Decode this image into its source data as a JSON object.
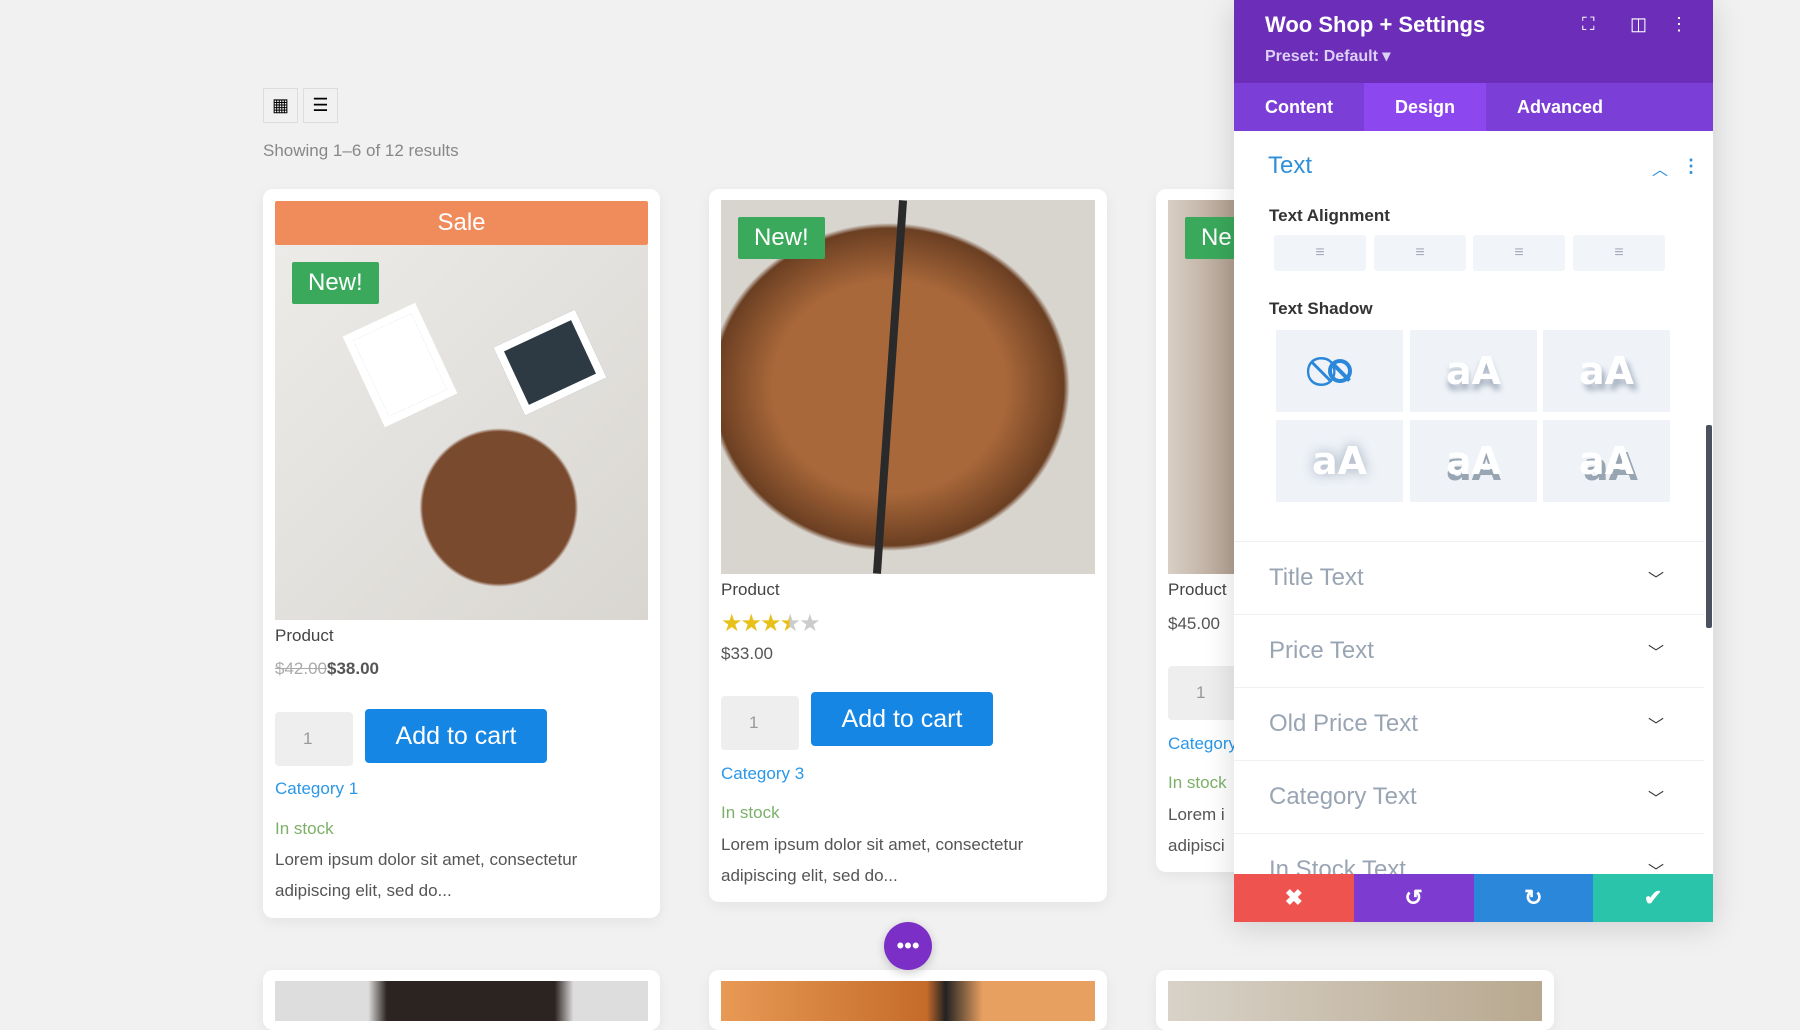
{
  "toolbar": {
    "grid_icon": "grid-view-icon",
    "list_icon": "list-view-icon"
  },
  "result_count": "Showing 1–6 of 12 results",
  "products": [
    {
      "sale": "Sale",
      "new": "New!",
      "title": "Product",
      "old_price": "$42.00",
      "price": "$38.00",
      "qty": "1",
      "add_to_cart": "Add to cart",
      "category": "Category 1",
      "stock": "In stock",
      "desc_1": "Lorem ipsum dolor sit amet, consectetur",
      "desc_2": "adipiscing elit, sed do..."
    },
    {
      "new": "New!",
      "title": "Product",
      "rating": 3.5,
      "rating_max": 5,
      "price": "$33.00",
      "qty": "1",
      "add_to_cart": "Add to cart",
      "category": "Category 3",
      "stock": "In stock",
      "desc_1": "Lorem ipsum dolor sit amet, consectetur",
      "desc_2": "adipiscing elit, sed do..."
    },
    {
      "new": "Ne",
      "title": "Product",
      "price": "$45.00",
      "qty": "1",
      "category": "Category",
      "stock": "In stock",
      "desc_1": "Lorem i",
      "desc_2": "adipisci"
    }
  ],
  "panel": {
    "title": "Woo Shop + Settings",
    "preset": "Preset: Default ▾",
    "tabs": [
      "Content",
      "Design",
      "Advanced"
    ],
    "active_tab": "Design",
    "section": "Text",
    "text_alignment_label": "Text Alignment",
    "text_shadow_label": "Text Shadow",
    "shadow_sample": "aA",
    "accordions": [
      "Title Text",
      "Price Text",
      "Old Price Text",
      "Category Text",
      "In Stock Text"
    ]
  },
  "colors": {
    "header": "#6c2eb9",
    "tabs": "#7b3fd8",
    "cancel": "#ef5350",
    "undo": "#7e3bd0",
    "redo": "#2b87da",
    "save": "#29c4a9",
    "add_to_cart": "#1586e4",
    "sale": "#f08c5c",
    "new": "#3aa95b"
  }
}
